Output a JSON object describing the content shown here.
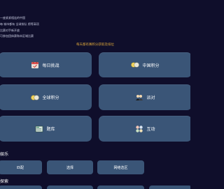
{
  "notes": [
    "一座紧紧相连的中国",
    "每 城市都有 全球排队  榜等高项",
    "比赛对手新开放",
    "可参加团体赛和本区域比赛"
  ],
  "banner": "每天都有赛积分获取及排位",
  "tiles": {
    "daily_challenge": "每日挑战",
    "china_points": "中国积分",
    "global_points": "全球积分",
    "party": "派对",
    "question_bank": "题库",
    "interact": "互动"
  },
  "sections": {
    "entertainment": "娱乐",
    "explore": "探索"
  },
  "entertainment_buttons": {
    "match": "匹配",
    "select": "选择",
    "net_select": "网络选区"
  },
  "colors": {
    "background": "#0f0e2b",
    "tile": "#3a5577",
    "banner_text": "#d9a43a"
  },
  "icons": {
    "daily_challenge": "calendar-icon",
    "china_points": "coins-icon",
    "global_points": "coins-icon",
    "party": "people-icon",
    "question_bank": "book-icon",
    "interact": "interaction-icon"
  }
}
